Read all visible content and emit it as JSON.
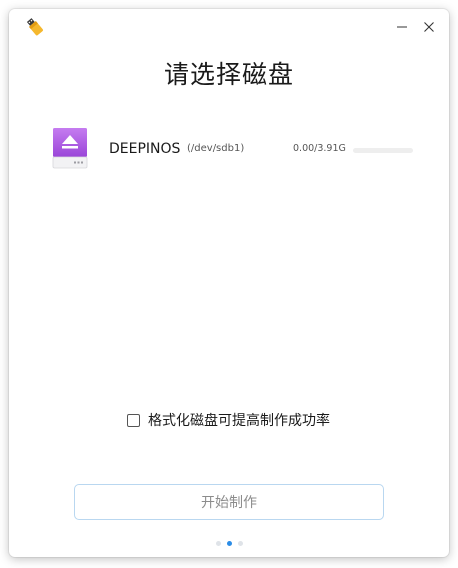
{
  "window": {
    "app_icon": "usb-drive-icon",
    "minimize_icon": "minimize-icon",
    "close_icon": "close-icon"
  },
  "page": {
    "title": "请选择磁盘"
  },
  "disks": [
    {
      "icon": "removable-disk-icon",
      "name": "DEEPINOS",
      "path": "(/dev/sdb1)",
      "size": "0.00/3.91G",
      "usage_fraction": 0.0
    }
  ],
  "options": {
    "format_label": "格式化磁盘可提高制作成功率",
    "format_checked": false
  },
  "actions": {
    "start_label": "开始制作"
  },
  "pager": {
    "total_steps": 3,
    "current_step": 2
  },
  "colors": {
    "accent": "#2b8ce6",
    "disk_icon": "#b05ee6",
    "button_border": "#b9d7f0"
  }
}
